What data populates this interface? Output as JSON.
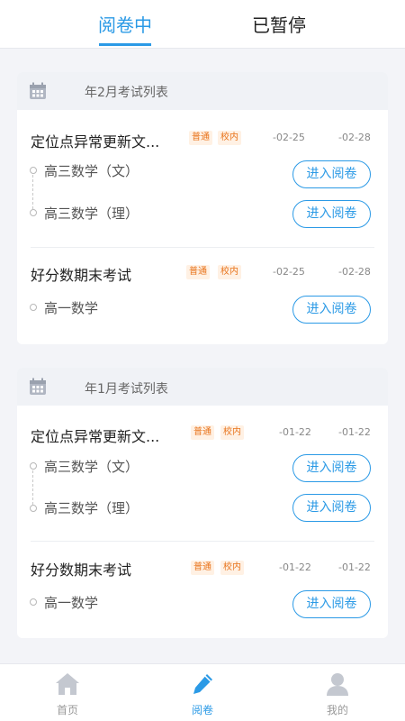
{
  "tabs": {
    "active": "阅卷中",
    "inactive": "已暂停"
  },
  "colors": {
    "accent": "#2b9ae6",
    "tag_text": "#e8741c",
    "tag_bg": "#fff1e4"
  },
  "groups": [
    {
      "title": "年2月考试列表",
      "exams": [
        {
          "name": "定位点异常更新文...",
          "tags": [
            "普通",
            "校内"
          ],
          "start": "-02-25",
          "end": "-02-28",
          "subjects": [
            "高三数学（文）",
            "高三数学（理）"
          ]
        },
        {
          "name": "好分数期末考试",
          "tags": [
            "普通",
            "校内"
          ],
          "start": "-02-25",
          "end": "-02-28",
          "subjects": [
            "高一数学"
          ]
        }
      ]
    },
    {
      "title": "年1月考试列表",
      "exams": [
        {
          "name": "定位点异常更新文...",
          "tags": [
            "普通",
            "校内"
          ],
          "start": "-01-22",
          "end": "-01-22",
          "subjects": [
            "高三数学（文）",
            "高三数学（理）"
          ]
        },
        {
          "name": "好分数期末考试",
          "tags": [
            "普通",
            "校内"
          ],
          "start": "-01-22",
          "end": "-01-22",
          "subjects": [
            "高一数学"
          ]
        }
      ]
    }
  ],
  "enter_label": "进入阅卷",
  "nav": {
    "home": "首页",
    "grading": "阅卷",
    "mine": "我的"
  }
}
